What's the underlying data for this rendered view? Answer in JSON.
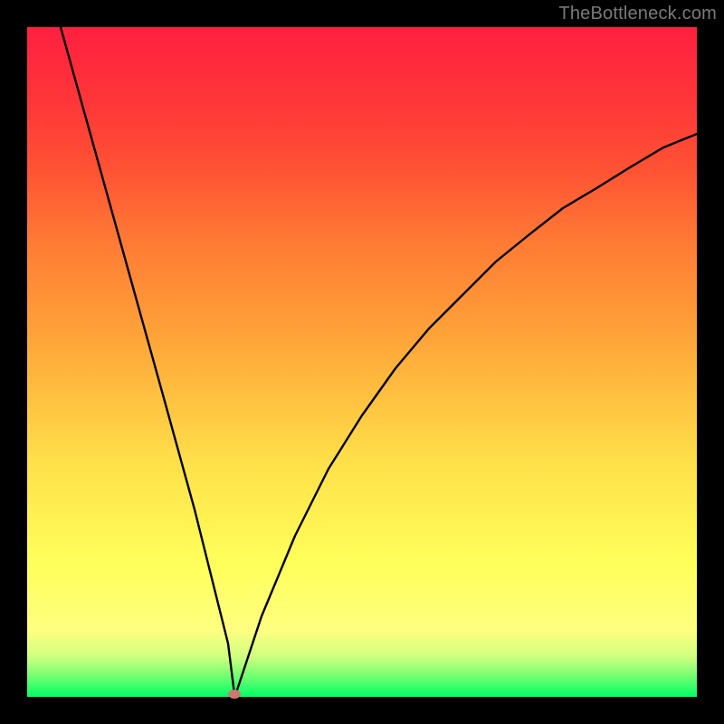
{
  "attribution": {
    "text": "TheBottleneck.com"
  },
  "chart_data": {
    "type": "line",
    "title": "",
    "xlabel": "",
    "ylabel": "",
    "xlim": [
      0,
      100
    ],
    "ylim": [
      0,
      100
    ],
    "x": [
      5,
      10,
      15,
      20,
      25,
      30,
      31,
      32,
      35,
      40,
      45,
      50,
      55,
      60,
      65,
      70,
      75,
      80,
      85,
      90,
      95,
      100
    ],
    "values": [
      100,
      82,
      64,
      46,
      28,
      8,
      0,
      3,
      12,
      24,
      34,
      42,
      49,
      55,
      60,
      65,
      69,
      73,
      76,
      79,
      82,
      84
    ],
    "marker": {
      "x": 31,
      "y": 0
    },
    "gradient_stops": [
      {
        "pct": 0,
        "color": "#00ff66"
      },
      {
        "pct": 6,
        "color": "#d0ff80"
      },
      {
        "pct": 20,
        "color": "#ffff5a"
      },
      {
        "pct": 45,
        "color": "#ffc040"
      },
      {
        "pct": 68,
        "color": "#ff7a34"
      },
      {
        "pct": 100,
        "color": "#ff2040"
      }
    ]
  }
}
